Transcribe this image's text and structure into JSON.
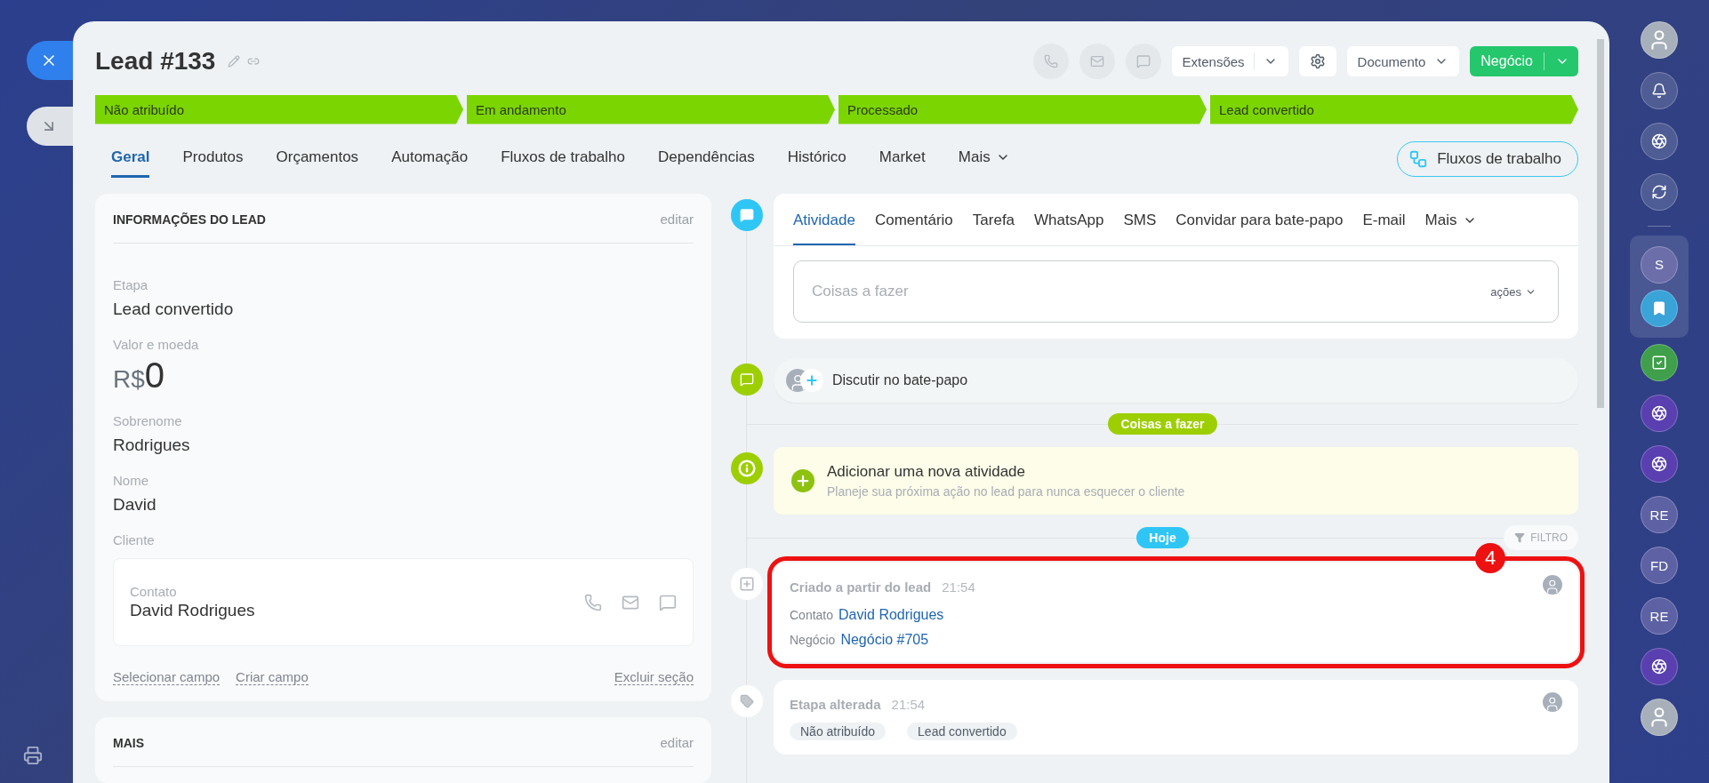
{
  "title": "Lead #133",
  "header": {
    "extensions": "Extensões",
    "document": "Documento",
    "deal": "Negócio"
  },
  "stages": [
    "Não atribuído",
    "Em andamento",
    "Processado",
    "Lead convertido"
  ],
  "tabs": [
    {
      "label": "Geral",
      "selected": true
    },
    {
      "label": "Produtos",
      "selected": false
    },
    {
      "label": "Orçamentos",
      "selected": false
    },
    {
      "label": "Automação",
      "selected": false
    },
    {
      "label": "Fluxos de trabalho",
      "selected": false
    },
    {
      "label": "Dependências",
      "selected": false
    },
    {
      "label": "Histórico",
      "selected": false
    },
    {
      "label": "Market",
      "selected": false
    }
  ],
  "tabs_more": "Mais",
  "workflows_button": "Fluxos de trabalho",
  "lead_info": {
    "title": "INFORMAÇÕES DO LEAD",
    "edit": "editar",
    "fields": [
      {
        "kind": "text",
        "label": "Etapa",
        "value": "Lead convertido"
      },
      {
        "kind": "money",
        "label": "Valor e moeda",
        "currency": "R$",
        "value": "0"
      },
      {
        "kind": "text",
        "label": "Sobrenome",
        "value": "Rodrigues"
      },
      {
        "kind": "text",
        "label": "Nome",
        "value": "David"
      },
      {
        "kind": "client",
        "label": "Cliente",
        "contact_label": "Contato",
        "value": "David Rodrigues"
      }
    ],
    "links": [
      "Selecionar campo",
      "Criar campo"
    ],
    "delete": "Excluir seção"
  },
  "more_section": {
    "title": "MAIS",
    "edit": "editar"
  },
  "activity": {
    "tabs": [
      {
        "label": "Atividade",
        "selected": true
      },
      {
        "label": "Comentário",
        "selected": false
      },
      {
        "label": "Tarefa",
        "selected": false
      },
      {
        "label": "WhatsApp",
        "selected": false
      },
      {
        "label": "SMS",
        "selected": false
      },
      {
        "label": "Convidar para bate-papo",
        "selected": false
      },
      {
        "label": "E-mail",
        "selected": false
      }
    ],
    "more": "Mais",
    "placeholder": "Coisas a fazer",
    "actions": "ações"
  },
  "chat": "Discutir no bate-papo",
  "todo_badge": "Coisas a fazer",
  "add_activity": {
    "title": "Adicionar uma nova atividade",
    "hint": "Planeje sua próxima ação no lead para nunca esquecer o cliente"
  },
  "today_badge": "Hoje",
  "filter": "FILTRO",
  "events": [
    {
      "kind": "created",
      "title": "Criado a partir do lead",
      "time": "21:54",
      "highlighted": true,
      "annotation": "4",
      "rows": [
        {
          "label": "Contato",
          "link": "David Rodrigues"
        },
        {
          "label": "Negócio",
          "link": "Negócio #705"
        }
      ]
    },
    {
      "kind": "stage",
      "title": "Etapa alterada",
      "time": "21:54",
      "highlighted": false,
      "stages": [
        "Não atribuído",
        "Lead convertido"
      ]
    }
  ],
  "sidebar": {
    "top": [
      {
        "kind": "avatar"
      },
      {
        "kind": "bell"
      },
      {
        "kind": "logo"
      },
      {
        "kind": "exchange"
      }
    ],
    "pinned": [
      {
        "kind": "initials",
        "text": "S"
      },
      {
        "kind": "bookmark"
      }
    ],
    "apps": [
      {
        "kind": "task"
      },
      {
        "kind": "app"
      },
      {
        "kind": "app"
      },
      {
        "kind": "initials",
        "text": "RE"
      },
      {
        "kind": "initials",
        "text": "FD"
      },
      {
        "kind": "initials",
        "text": "RE"
      },
      {
        "kind": "app"
      },
      {
        "kind": "avatar"
      }
    ]
  }
}
